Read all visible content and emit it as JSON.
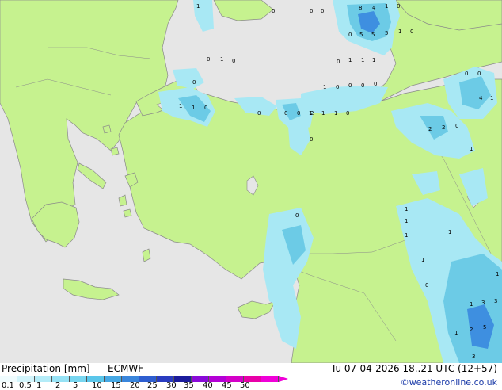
{
  "map": {
    "colors": {
      "sea": "#e6e6e6",
      "land": "#c6f28f",
      "coast": "#8a8a8a",
      "rain_light": "#a8e8f4",
      "rain_med": "#6ccbe6",
      "rain_heavy": "#3e8fe0"
    },
    "values": [
      "8",
      "4",
      "1",
      "0",
      "0",
      "1",
      "0",
      "0",
      "0",
      "5",
      "5",
      "5",
      "1",
      "0",
      "0",
      "1",
      "1",
      "1",
      "0",
      "1",
      "0",
      "1",
      "0",
      "0",
      "0",
      "0",
      "0",
      "1",
      "1",
      "0",
      "0",
      "0",
      "0",
      "1",
      "1",
      "2",
      "1",
      "0",
      "0",
      "0",
      "0",
      "4",
      "1",
      "2",
      "2",
      "0",
      "1",
      "0",
      "1",
      "1",
      "1",
      "1",
      "1",
      "0",
      "3",
      "1",
      "3",
      "1",
      "1",
      "5",
      "2",
      "3"
    ]
  },
  "legend": {
    "title": "Precipitation [mm]",
    "model": "ECMWF",
    "ticks": [
      "0.1",
      "0.5",
      "1",
      "2",
      "5",
      "10",
      "15",
      "20",
      "25",
      "30",
      "35",
      "40",
      "45",
      "50"
    ],
    "colors": [
      "#f0fcfe",
      "#d2f4fb",
      "#b4ecf8",
      "#96e2f5",
      "#78d6f0",
      "#5ac6ea",
      "#46a8e4",
      "#3a86dc",
      "#2e5ed0",
      "#2a3cc0",
      "#1c1c9c",
      "#8a0ad8",
      "#b400d6",
      "#d400c8",
      "#e800a8",
      "#f000d8"
    ]
  },
  "valid_time": "Tu 07-04-2026 18..21 UTC (12+57)",
  "credit": "©weatheronline.co.uk"
}
